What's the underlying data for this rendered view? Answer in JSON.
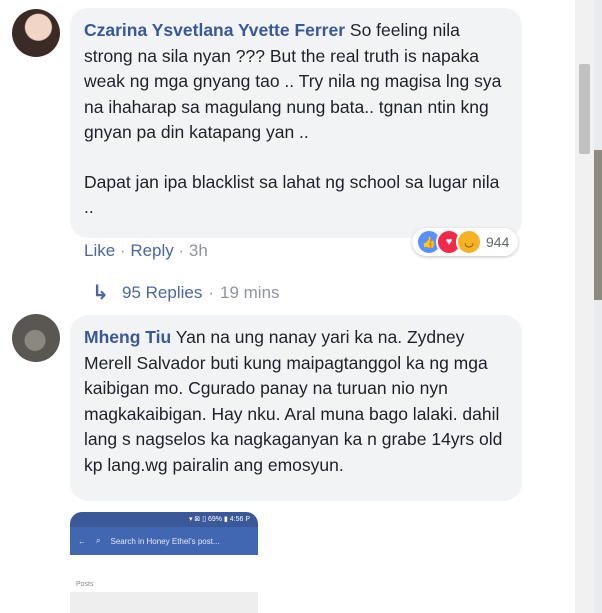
{
  "comments": [
    {
      "author": "Czarina Ysvetlana Yvette Ferrer",
      "paragraphs": [
        "So feeling nila strong na sila nyan ??? But the real truth is napaka weak ng mga gnyang tao .. Try nila ng magisa lng sya na ihaharap sa magulang nung bata.. tgnan ntin kng gnyan pa din katapang yan ..",
        "Dapat jan ipa blacklist sa lahat ng school sa lugar nila .."
      ],
      "like_label": "Like",
      "reply_label": "Reply",
      "time": "3h",
      "reaction_count": "944",
      "replies_label": "95 Replies",
      "replies_time": "19 mins"
    },
    {
      "author": "Mheng Tiu",
      "text": "Yan na ung nanay yari ka na. Zydney Merell Salvador buti kung maipagtanggol ka ng mga kaibigan mo. Cgurado panay na turuan nio nyn magkakaibigan. Hay nku. Aral muna bago lalaki. dahil lang s nagselos ka nagkaganyan ka n grabe 14yrs old kp lang.wg pairalin ang emosyun."
    }
  ],
  "attachment": {
    "status": "▾ ⊠ ▯ 69% ▮ 4:56 P",
    "search_placeholder": "Search in Honey Ethel's post...",
    "section_label": "Posts"
  },
  "icons": [
    "reply-arrow-icon",
    "like-reaction-icon",
    "love-reaction-icon",
    "haha-reaction-icon",
    "back-arrow-icon",
    "search-icon"
  ],
  "colors": {
    "author": "#385898",
    "link": "#4b67a1",
    "bubble": "#f2f3f5",
    "meta": "#90949c"
  }
}
